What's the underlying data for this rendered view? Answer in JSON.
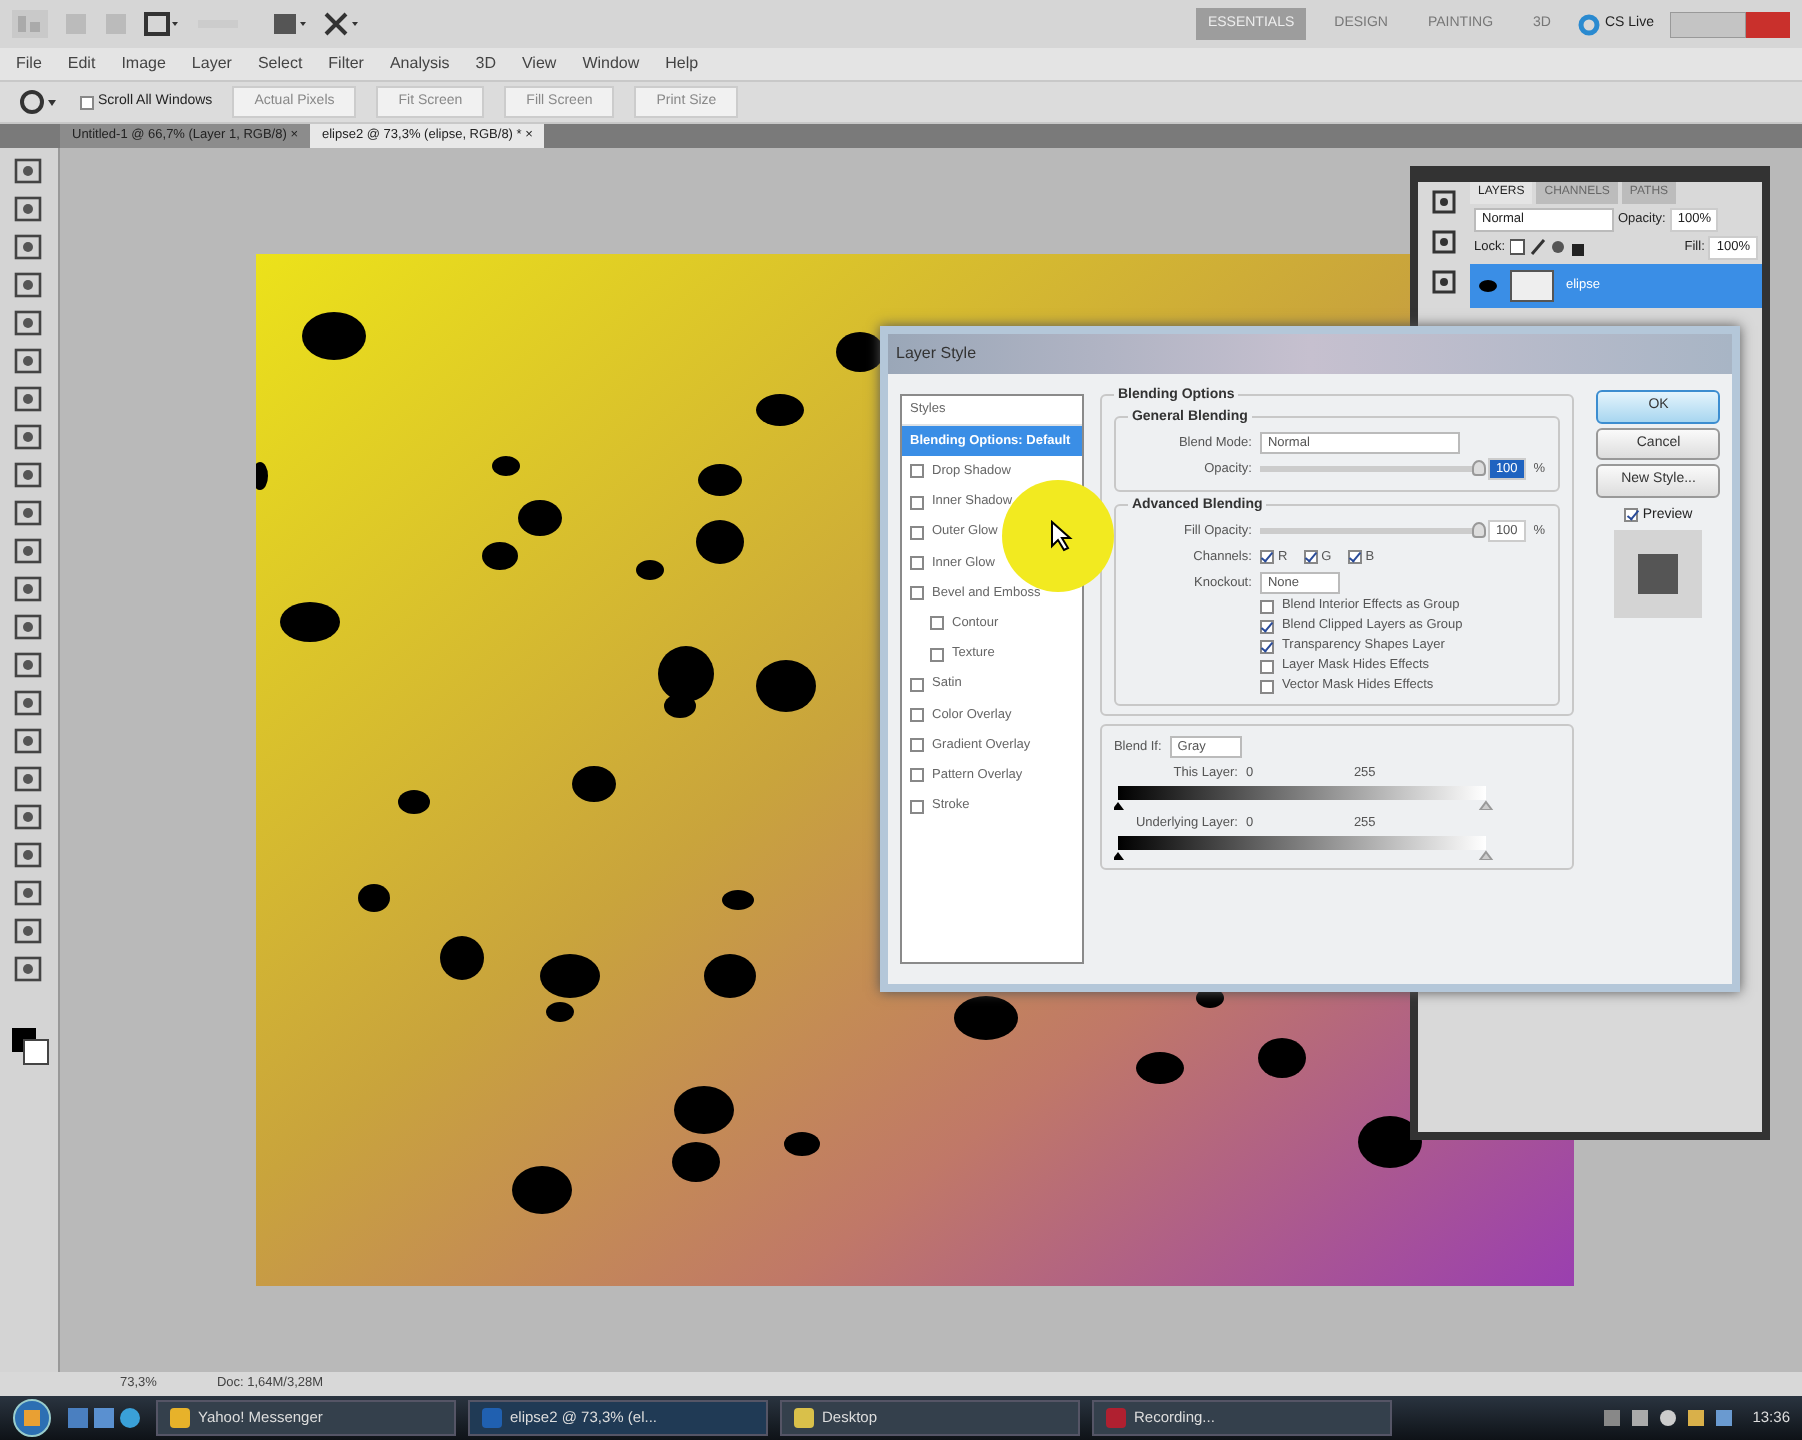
{
  "app_bar": {
    "workspaces": [
      {
        "label": "ESSENTIALS",
        "selected": true
      },
      {
        "label": "DESIGN",
        "selected": false
      },
      {
        "label": "PAINTING",
        "selected": false
      },
      {
        "label": "3D",
        "selected": false
      }
    ],
    "cs_live": "CS Live"
  },
  "menu": [
    "File",
    "Edit",
    "Image",
    "Layer",
    "Select",
    "Filter",
    "Analysis",
    "3D",
    "View",
    "Window",
    "Help"
  ],
  "options_bar": {
    "scroll_all": {
      "label": "Scroll All Windows",
      "checked": false
    },
    "buttons": [
      "Actual Pixels",
      "Fit Screen",
      "Fill Screen",
      "Print Size"
    ]
  },
  "doc_tabs": [
    {
      "label": "Untitled-1 @ 66,7% (Layer 1, RGB/8) ×",
      "selected": false
    },
    {
      "label": "elipse2 @ 73,3% (elipse, RGB/8) * ×",
      "selected": true
    }
  ],
  "layers_panel": {
    "tabs": [
      {
        "label": "LAYERS",
        "selected": true
      },
      {
        "label": "CHANNELS",
        "selected": false
      },
      {
        "label": "PATHS",
        "selected": false
      }
    ],
    "blend_mode": "Normal",
    "opacity_label": "Opacity:",
    "opacity": "100%",
    "lock_label": "Lock:",
    "fill_label": "Fill:",
    "fill": "100%",
    "layers": [
      {
        "name": "elipse",
        "selected": true,
        "visible": true
      }
    ]
  },
  "layer_style": {
    "title": "Layer Style",
    "styles_header": "Styles",
    "styles": [
      {
        "label": "Blending Options: Default",
        "kind": "header",
        "selected": true
      },
      {
        "label": "Drop Shadow",
        "kind": "effect",
        "checked": false,
        "selected": false
      },
      {
        "label": "Inner Shadow",
        "kind": "effect",
        "checked": false,
        "selected": false
      },
      {
        "label": "Outer Glow",
        "kind": "effect",
        "checked": false,
        "selected": false
      },
      {
        "label": "Inner Glow",
        "kind": "effect",
        "checked": false,
        "selected": false
      },
      {
        "label": "Bevel and Emboss",
        "kind": "effect",
        "checked": false,
        "selected": false,
        "children": [
          {
            "label": "Contour",
            "kind": "effect",
            "checked": false,
            "selected": false
          },
          {
            "label": "Texture",
            "kind": "effect",
            "checked": false,
            "selected": false
          }
        ]
      },
      {
        "label": "Satin",
        "kind": "effect",
        "checked": false,
        "selected": false
      },
      {
        "label": "Color Overlay",
        "kind": "effect",
        "checked": false,
        "selected": false
      },
      {
        "label": "Gradient Overlay",
        "kind": "effect",
        "checked": false,
        "selected": false
      },
      {
        "label": "Pattern Overlay",
        "kind": "effect",
        "checked": false,
        "selected": false
      },
      {
        "label": "Stroke",
        "kind": "effect",
        "checked": false,
        "selected": false
      }
    ],
    "section_title": "Blending Options",
    "general": {
      "title": "General Blending",
      "blend_mode_label": "Blend Mode:",
      "blend_mode": "Normal",
      "opacity_label": "Opacity:",
      "opacity": {
        "level": 1,
        "value": "100",
        "unit": "%"
      }
    },
    "advanced": {
      "title": "Advanced Blending",
      "fill_label": "Fill Opacity:",
      "fill": {
        "level": 1,
        "value": "100",
        "unit": "%"
      },
      "channels_label": "Channels:",
      "channels": [
        {
          "label": "R",
          "checked": true
        },
        {
          "label": "G",
          "checked": true
        },
        {
          "label": "B",
          "checked": true
        }
      ],
      "knockout_label": "Knockout:",
      "knockout": "None",
      "options": [
        {
          "label": "Blend Interior Effects as Group",
          "checked": false
        },
        {
          "label": "Blend Clipped Layers as Group",
          "checked": true
        },
        {
          "label": "Transparency Shapes Layer",
          "checked": true
        },
        {
          "label": "Layer Mask Hides Effects",
          "checked": false
        },
        {
          "label": "Vector Mask Hides Effects",
          "checked": false
        }
      ]
    },
    "blend_if": {
      "label": "Blend If:",
      "value": "Gray",
      "rows": [
        {
          "label": "This Layer:",
          "low": "0",
          "high": "255"
        },
        {
          "label": "Underlying Layer:",
          "low": "0",
          "high": "255"
        }
      ]
    },
    "buttons": [
      {
        "label": "OK",
        "default": true
      },
      {
        "label": "Cancel",
        "default": false
      },
      {
        "label": "New Style...",
        "default": false
      }
    ],
    "preview": {
      "label": "Preview",
      "checked": true
    }
  },
  "status_bar": {
    "zoom": "73,3%",
    "doc": "Doc: 1,64M/3,28M"
  },
  "taskbar": {
    "items": [
      {
        "label": "Yahoo! Messenger",
        "selected": false
      },
      {
        "label": "elipse2 @ 73,3% (el...",
        "selected": true
      },
      {
        "label": "Desktop",
        "selected": false
      },
      {
        "label": "Recording...",
        "selected": false
      }
    ],
    "clock": "13:36"
  }
}
